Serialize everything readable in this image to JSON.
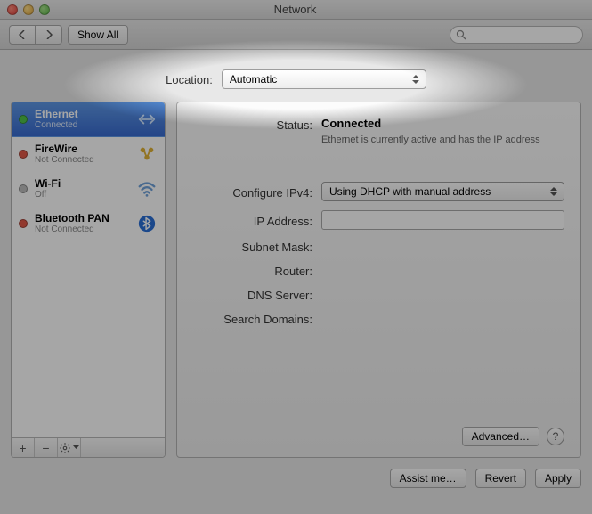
{
  "window": {
    "title": "Network"
  },
  "toolbar": {
    "show_all": "Show All",
    "search_placeholder": ""
  },
  "location": {
    "label": "Location:",
    "value": "Automatic"
  },
  "sidebar": {
    "services": [
      {
        "name": "Ethernet",
        "status_text": "Connected",
        "status": "green",
        "icon": "ethernet",
        "selected": true
      },
      {
        "name": "FireWire",
        "status_text": "Not Connected",
        "status": "red",
        "icon": "firewire",
        "selected": false
      },
      {
        "name": "Wi-Fi",
        "status_text": "Off",
        "status": "gray",
        "icon": "wifi",
        "selected": false
      },
      {
        "name": "Bluetooth PAN",
        "status_text": "Not Connected",
        "status": "red",
        "icon": "bluetooth",
        "selected": false
      }
    ],
    "footer": {
      "add": "+",
      "remove": "−",
      "gear": "gear"
    }
  },
  "detail": {
    "labels": {
      "status": "Status:",
      "configure_ipv4": "Configure IPv4:",
      "ip_address": "IP Address:",
      "subnet_mask": "Subnet Mask:",
      "router": "Router:",
      "dns_server": "DNS Server:",
      "search_domains": "Search Domains:"
    },
    "status_value": "Connected",
    "status_subtext": "Ethernet is currently active and has the IP address",
    "configure_ipv4_value": "Using DHCP with manual address",
    "ip_address_value": "",
    "subnet_mask_value": "",
    "router_value": "",
    "dns_server_value": "",
    "search_domains_value": "",
    "advanced": "Advanced…"
  },
  "bottom": {
    "assist": "Assist me…",
    "revert": "Revert",
    "apply": "Apply"
  }
}
